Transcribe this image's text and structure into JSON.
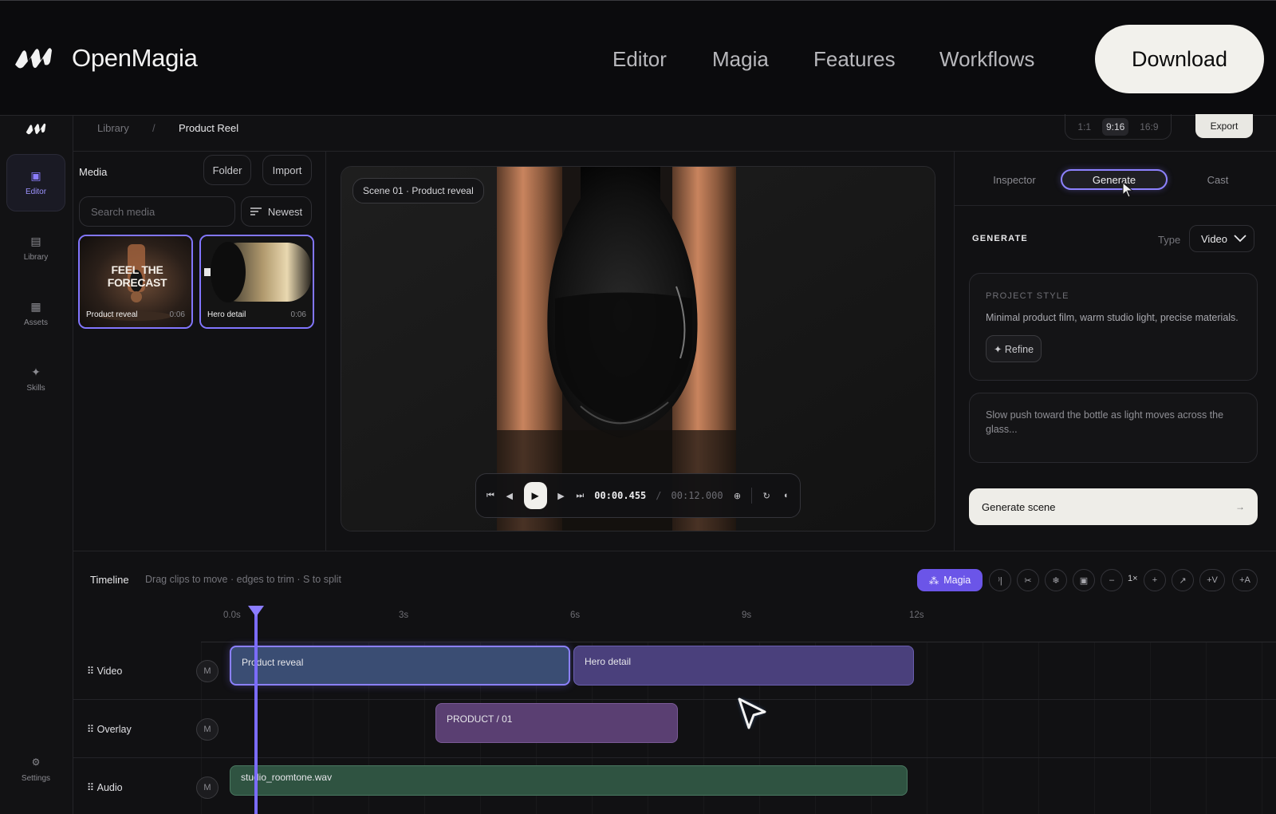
{
  "nav": {
    "brand": "OpenMagia",
    "links": [
      "Editor",
      "Magia",
      "Features",
      "Workflows"
    ],
    "download": "Download"
  },
  "rail": {
    "items": [
      {
        "label": "Editor",
        "icon": "square-icon"
      },
      {
        "label": "Library",
        "icon": "list-icon"
      },
      {
        "label": "Assets",
        "icon": "grid-icon"
      },
      {
        "label": "Skills",
        "icon": "sparkle-icon"
      }
    ],
    "settings": "Settings"
  },
  "breadcrumb": {
    "root": "Library",
    "sep": "/",
    "current": "Product Reel"
  },
  "ratios": [
    "1:1",
    "9:16",
    "16:9"
  ],
  "ratio_selected": "9:16",
  "export": "Export",
  "media": {
    "title": "Media",
    "folder": "Folder",
    "import": "Import",
    "search_placeholder": "Search media",
    "sort": "Newest",
    "items": [
      {
        "name": "Product reveal",
        "duration": "0:06",
        "overlay_text": "FEEL THE FORECAST"
      },
      {
        "name": "Hero detail",
        "duration": "0:06"
      }
    ]
  },
  "preview": {
    "scene_chip": "Scene 01 · Product reveal",
    "time_current": "00:00.455",
    "time_sep": "/",
    "time_total": "00:12.000"
  },
  "right": {
    "tabs": [
      "Inspector",
      "Generate",
      "Cast"
    ],
    "active_tab": "Generate",
    "generate_label": "GENERATE",
    "type_label": "Type",
    "type_value": "Video",
    "style_head": "PROJECT STYLE",
    "style_text": "Minimal product film, warm studio light, precise materials.",
    "refine": "✦ Refine",
    "prompt": "Slow push toward the bottle as light moves across the glass...",
    "generate_btn": "Generate scene"
  },
  "timeline": {
    "title": "Timeline",
    "hint": "Drag clips to move · edges to trim · S to split",
    "magia": "Magia",
    "tools": [
      "⁾|",
      "✂",
      "❄",
      "▣",
      "–",
      "1×",
      "+",
      "↗",
      "+V",
      "+A"
    ],
    "ticks": [
      "0.0s",
      "3s",
      "6s",
      "9s",
      "12s"
    ],
    "tracks": [
      {
        "label": "⠿ Video",
        "mute": "M"
      },
      {
        "label": "⠿ Overlay",
        "mute": "M"
      },
      {
        "label": "⠿ Audio",
        "mute": "M"
      }
    ],
    "clips": {
      "video1": "Product reveal",
      "video2": "Hero detail",
      "overlay": "PRODUCT / 01",
      "audio": "studio_roomtone.wav"
    },
    "playhead_seconds": 0.455
  },
  "colors": {
    "accent": "#8276ff",
    "magia_button": "#6b55e8",
    "video_clip": "#3a4d73",
    "audio_clip": "#2f5341",
    "overlay_clip": "#5a3f72"
  }
}
